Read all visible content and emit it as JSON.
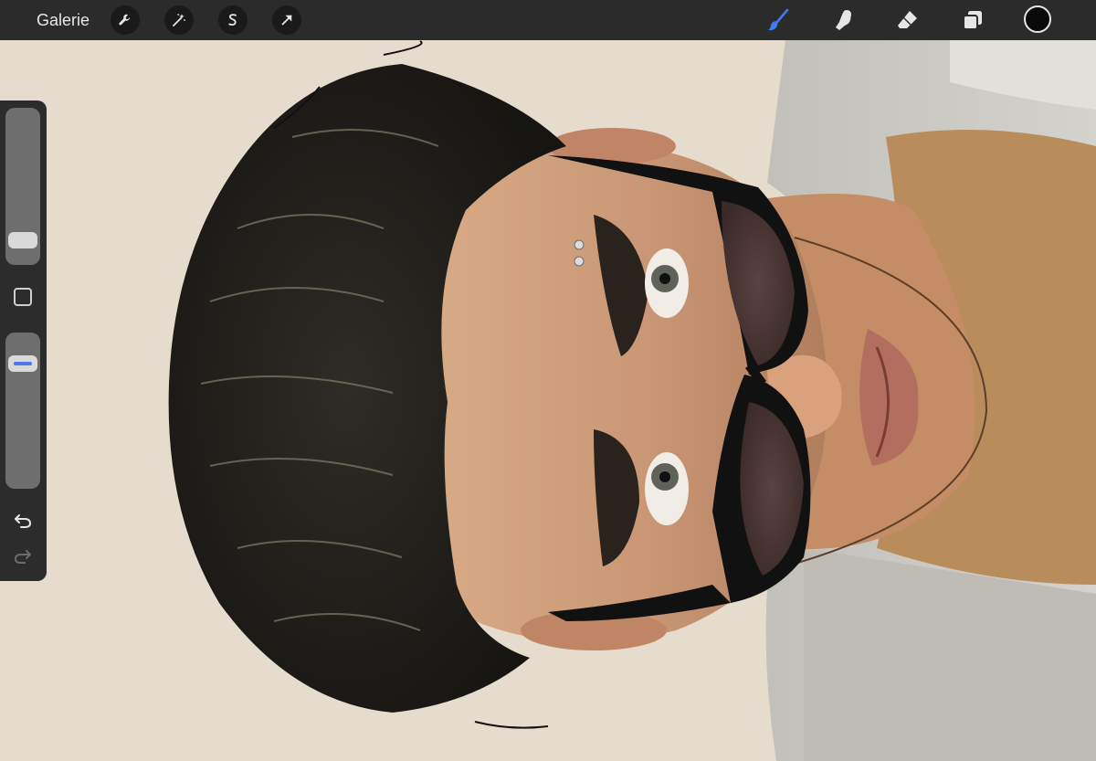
{
  "toolbar": {
    "gallery_label": "Galerie",
    "left_tools": [
      {
        "icon": "wrench-icon",
        "name": "actions"
      },
      {
        "icon": "magic-wand-icon",
        "name": "adjustments"
      },
      {
        "icon": "selection-s-icon",
        "name": "selection"
      },
      {
        "icon": "arrow-cursor-icon",
        "name": "transform"
      }
    ],
    "right_tools": [
      {
        "icon": "brush-icon",
        "name": "paint",
        "active": true
      },
      {
        "icon": "smudge-finger-icon",
        "name": "smudge",
        "active": false
      },
      {
        "icon": "eraser-icon",
        "name": "erase",
        "active": false
      },
      {
        "icon": "layers-icon",
        "name": "layers",
        "active": false
      }
    ],
    "current_color": "#0a0a0a",
    "active_color": "#3d7bf0",
    "icon_color": "#e6e6e6"
  },
  "sidebar": {
    "brush_size_level": 0.1,
    "opacity_level": 0.85,
    "modify_icon": "square-outline-icon",
    "undo_icon": "undo-arrow-icon",
    "redo_icon": "redo-arrow-icon",
    "redo_enabled": false
  },
  "canvas": {
    "background_color": "#e6dccd",
    "artwork": "portrait-illustration"
  }
}
